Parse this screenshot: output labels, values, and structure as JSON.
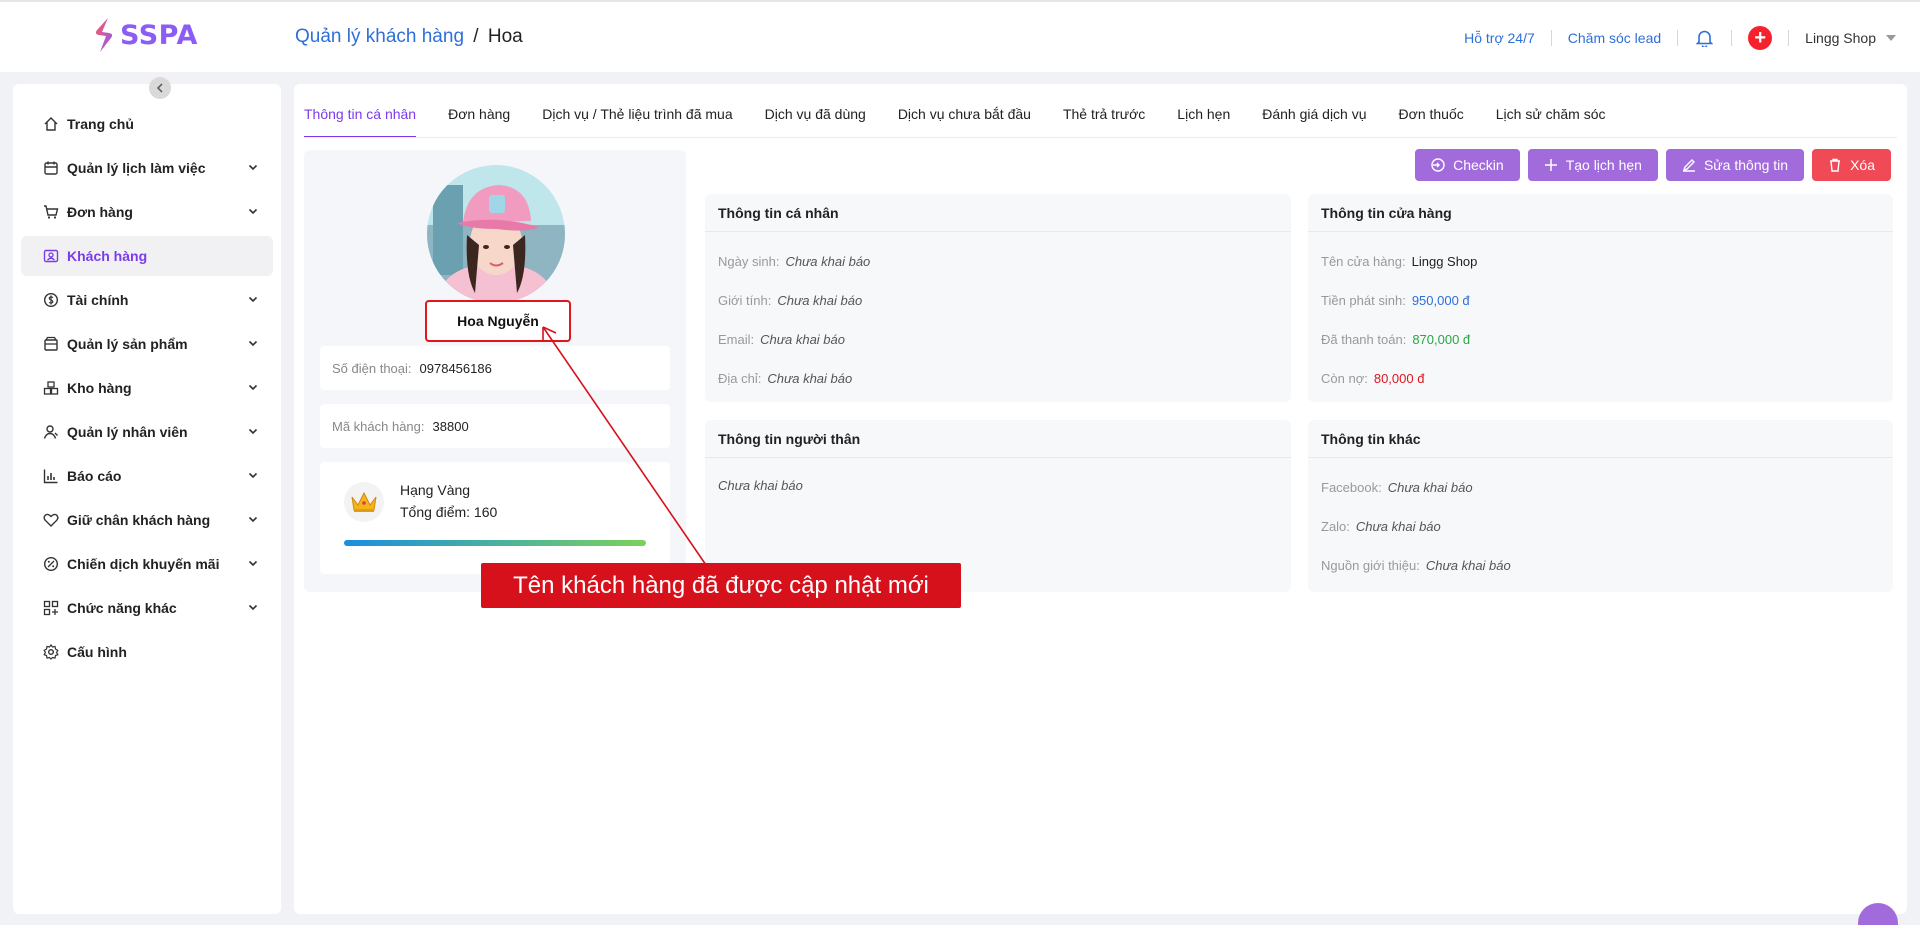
{
  "brand": {
    "name": "SSPA"
  },
  "breadcrumb": {
    "parent": "Quản lý khách hàng",
    "separator": "/",
    "current": "Hoa"
  },
  "header": {
    "support": "Hỗ trợ 24/7",
    "lead_care": "Chăm sóc lead",
    "shop": "Lingg Shop"
  },
  "sidebar": {
    "items": [
      {
        "label": "Trang chủ",
        "icon": "home-icon",
        "expandable": false,
        "active": false
      },
      {
        "label": "Quản lý lịch làm việc",
        "icon": "calendar-icon",
        "expandable": true,
        "active": false
      },
      {
        "label": "Đơn hàng",
        "icon": "cart-icon",
        "expandable": true,
        "active": false
      },
      {
        "label": "Khách hàng",
        "icon": "customer-icon",
        "expandable": false,
        "active": true
      },
      {
        "label": "Tài chính",
        "icon": "dollar-icon",
        "expandable": true,
        "active": false
      },
      {
        "label": "Quản lý sản phẩm",
        "icon": "box-icon",
        "expandable": true,
        "active": false
      },
      {
        "label": "Kho hàng",
        "icon": "warehouse-icon",
        "expandable": true,
        "active": false
      },
      {
        "label": "Quản lý nhân viên",
        "icon": "staff-icon",
        "expandable": true,
        "active": false
      },
      {
        "label": "Báo cáo",
        "icon": "report-icon",
        "expandable": true,
        "active": false
      },
      {
        "label": "Giữ chân khách hàng",
        "icon": "heart-icon",
        "expandable": true,
        "active": false
      },
      {
        "label": "Chiến dịch khuyến mãi",
        "icon": "promo-icon",
        "expandable": true,
        "active": false
      },
      {
        "label": "Chức năng khác",
        "icon": "grid-icon",
        "expandable": true,
        "active": false
      },
      {
        "label": "Cấu hình",
        "icon": "settings-icon",
        "expandable": false,
        "active": false
      }
    ]
  },
  "tabs": [
    "Thông tin cá nhân",
    "Đơn hàng",
    "Dịch vụ / Thẻ liệu trình đã mua",
    "Dịch vụ đã dùng",
    "Dịch vụ chưa bắt đầu",
    "Thẻ trả trước",
    "Lịch hẹn",
    "Đánh giá dịch vụ",
    "Đơn thuốc",
    "Lịch sử chăm sóc"
  ],
  "active_tab": 0,
  "profile": {
    "name": "Hoa Nguyễn",
    "phone_label": "Số điện thoại",
    "phone": "0978456186",
    "code_label": "Mã khách hàng",
    "code": "38800",
    "rank": "Hạng Vàng",
    "points_text": "Tổng điểm: 160",
    "rank_progress": 1.0
  },
  "actions": {
    "checkin": "Checkin",
    "appointment": "Tạo lịch hẹn",
    "edit": "Sửa thông tin",
    "delete": "Xóa"
  },
  "personal": {
    "title": "Thông tin cá nhân",
    "rows": [
      {
        "key": "Ngày sinh",
        "value": "Chưa khai báo"
      },
      {
        "key": "Giới tính",
        "value": "Chưa khai báo"
      },
      {
        "key": "Email",
        "value": "Chưa khai báo"
      },
      {
        "key": "Địa chỉ",
        "value": "Chưa khai báo"
      }
    ]
  },
  "store": {
    "title": "Thông tin cửa hàng",
    "rows": [
      {
        "key": "Tên cửa hàng",
        "value": "Lingg Shop",
        "color": "#222222"
      },
      {
        "key": "Tiền phát sinh",
        "value": "950,000 đ",
        "color": "#2f6fd8"
      },
      {
        "key": "Đã thanh toán",
        "value": "870,000 đ",
        "color": "#28a745"
      },
      {
        "key": "Còn nợ",
        "value": "80,000 đ",
        "color": "#e0161e"
      }
    ]
  },
  "relatives": {
    "title": "Thông tin người thân",
    "empty": "Chưa khai báo"
  },
  "other": {
    "title": "Thông tin khác",
    "rows": [
      {
        "key": "Facebook",
        "value": "Chưa khai báo"
      },
      {
        "key": "Zalo",
        "value": "Chưa khai báo"
      },
      {
        "key": "Nguồn giới thiệu",
        "value": "Chưa khai báo"
      }
    ]
  },
  "annotation": {
    "text": "Tên khách hàng đã được cập nhật mới",
    "color": "#d6111c"
  }
}
